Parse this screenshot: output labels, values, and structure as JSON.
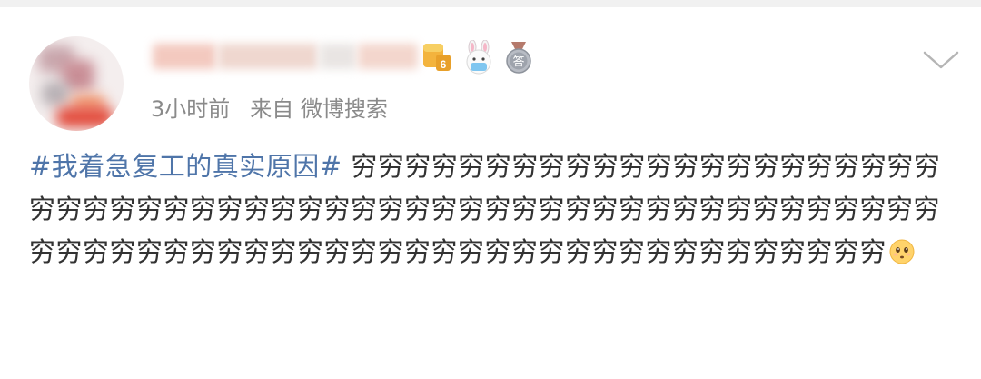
{
  "post": {
    "meta": {
      "time": "3小时前",
      "source": "来自 微博搜索"
    },
    "level_badge_number": "6",
    "medal_badge_char": "答",
    "hashtag": "#我着急复工的真实原因#",
    "body_text": "穷穷穷穷穷穷穷穷穷穷穷穷穷穷穷穷穷穷穷穷穷穷穷穷穷穷穷穷穷穷穷穷穷穷穷穷穷穷穷穷穷穷穷穷穷穷穷穷穷穷穷穷穷穷穷穷穷穷穷穷穷穷穷穷穷穷穷穷穷穷穷穷穷穷穷穷穷穷穷穷穷穷穷穷穷穷穷穷",
    "trailing_emoji": "sad-face-emoji"
  },
  "colors": {
    "hashtag": "#4f75a9",
    "body": "#333333",
    "meta": "#8a8a8a",
    "top_strip": "#f1f1f1"
  }
}
